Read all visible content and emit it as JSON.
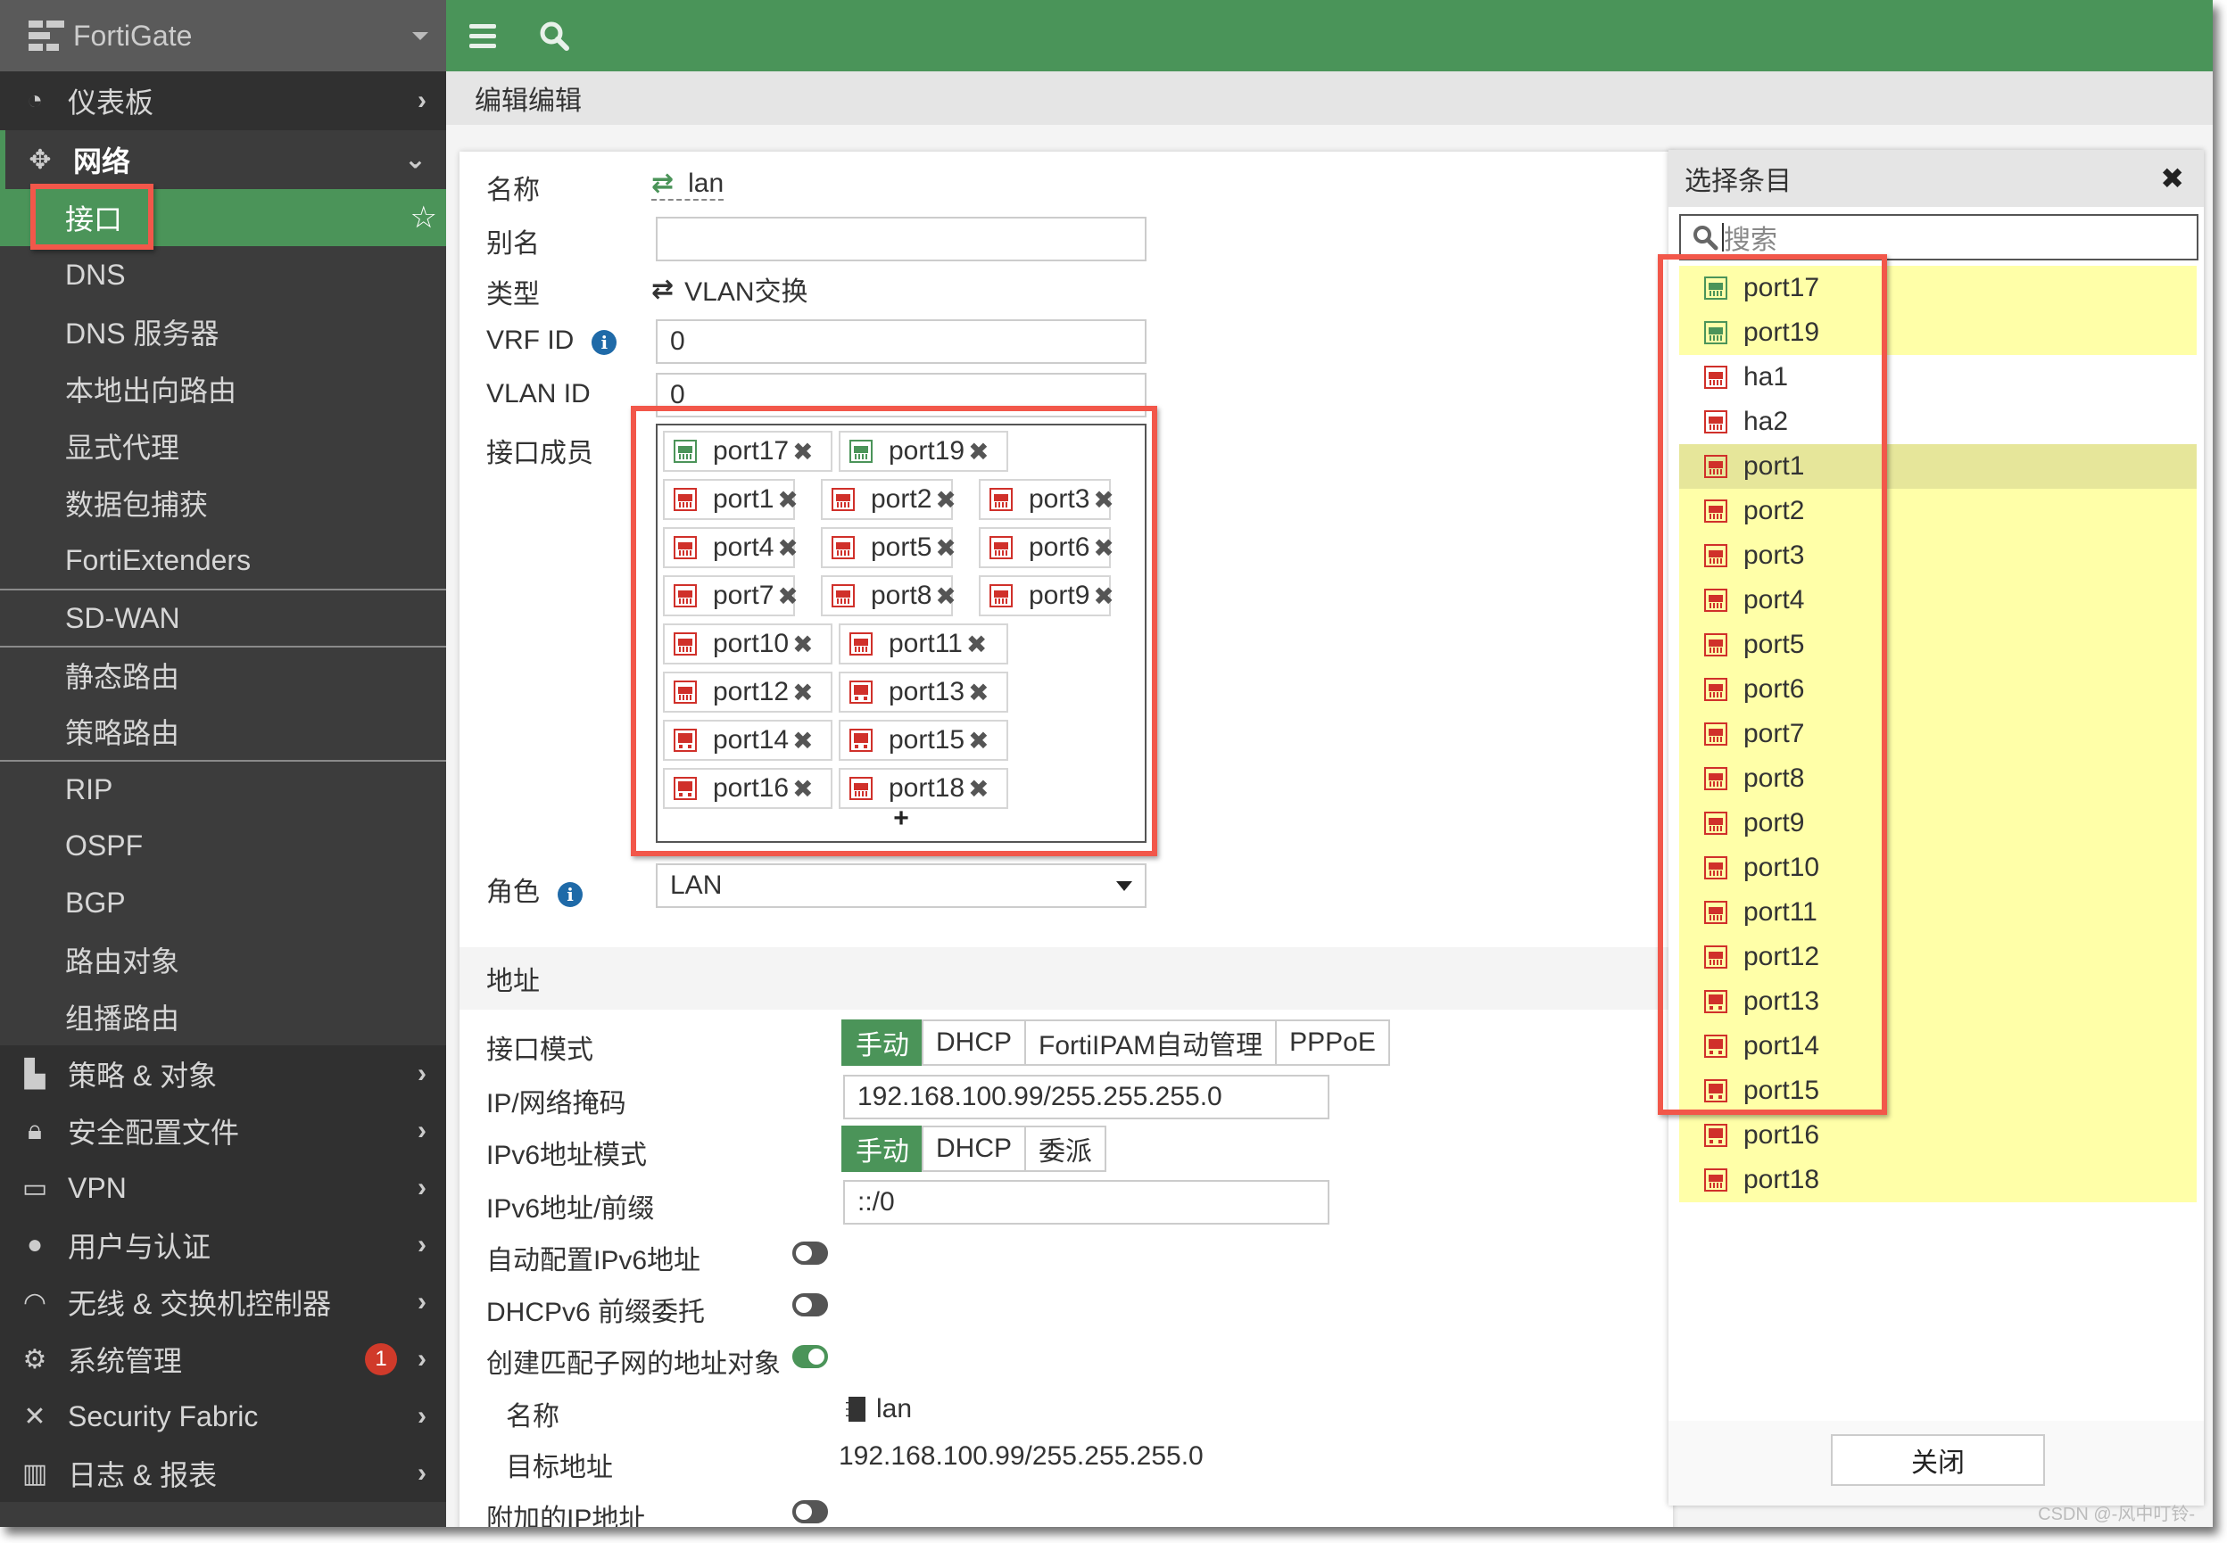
{
  "brand": "FortiGate",
  "topbar": {
    "menu_icon": "hamburger-icon",
    "search_icon": "search-icon"
  },
  "breadcrumb": "编辑编辑",
  "sidebar": {
    "top_items": [
      {
        "label": "仪表板",
        "icon": "dashboard-icon"
      },
      {
        "label": "网络",
        "icon": "network-move-icon",
        "expanded": true
      }
    ],
    "network_sub": [
      "接口",
      "DNS",
      "DNS 服务器",
      "本地出向路由",
      "显式代理",
      "数据包捕获",
      "FortiExtenders",
      "SD-WAN",
      "静态路由",
      "策略路由",
      "RIP",
      "OSPF",
      "BGP",
      "路由对象",
      "组播路由"
    ],
    "active_sub": "接口",
    "bottom_items": [
      {
        "label": "策略 & 对象",
        "icon": "policy-icon"
      },
      {
        "label": "安全配置文件",
        "icon": "lock-icon"
      },
      {
        "label": "VPN",
        "icon": "laptop-icon"
      },
      {
        "label": "用户与认证",
        "icon": "user-icon"
      },
      {
        "label": "无线 & 交换机控制器",
        "icon": "wifi-icon"
      },
      {
        "label": "系统管理",
        "icon": "gear-icon",
        "badge": "1"
      },
      {
        "label": "Security Fabric",
        "icon": "fabric-icon"
      },
      {
        "label": "日志 & 报表",
        "icon": "chart-icon"
      }
    ]
  },
  "form": {
    "name_label": "名称",
    "name_value": "lan",
    "alias_label": "别名",
    "alias_value": "",
    "type_label": "类型",
    "type_value": "VLAN交换",
    "vrf_label": "VRF ID",
    "vrf_value": "0",
    "vlan_label": "VLAN ID",
    "vlan_value": "0",
    "members_label": "接口成员",
    "members": [
      {
        "name": "port17",
        "color": "green",
        "kind": "rj45"
      },
      {
        "name": "port19",
        "color": "green",
        "kind": "rj45"
      },
      {
        "name": "port1",
        "color": "red",
        "kind": "rj45"
      },
      {
        "name": "port2",
        "color": "red",
        "kind": "rj45"
      },
      {
        "name": "port3",
        "color": "red",
        "kind": "rj45"
      },
      {
        "name": "port4",
        "color": "red",
        "kind": "rj45"
      },
      {
        "name": "port5",
        "color": "red",
        "kind": "rj45"
      },
      {
        "name": "port6",
        "color": "red",
        "kind": "rj45"
      },
      {
        "name": "port7",
        "color": "red",
        "kind": "rj45"
      },
      {
        "name": "port8",
        "color": "red",
        "kind": "rj45"
      },
      {
        "name": "port9",
        "color": "red",
        "kind": "rj45"
      },
      {
        "name": "port10",
        "color": "red",
        "kind": "rj45"
      },
      {
        "name": "port11",
        "color": "red",
        "kind": "rj45"
      },
      {
        "name": "port12",
        "color": "red",
        "kind": "rj45"
      },
      {
        "name": "port13",
        "color": "red",
        "kind": "sfp"
      },
      {
        "name": "port14",
        "color": "red",
        "kind": "sfp"
      },
      {
        "name": "port15",
        "color": "red",
        "kind": "sfp"
      },
      {
        "name": "port16",
        "color": "red",
        "kind": "sfp"
      },
      {
        "name": "port18",
        "color": "red",
        "kind": "rj45"
      }
    ],
    "add_label": "+",
    "role_label": "角色",
    "role_value": "LAN",
    "address_section": "地址",
    "mode_label": "接口模式",
    "mode_options": [
      "手动",
      "DHCP",
      "FortiIPAM自动管理",
      "PPPoE"
    ],
    "mode_selected": "手动",
    "ip_label": "IP/网络掩码",
    "ip_value": "192.168.100.99/255.255.255.0",
    "ipv6_mode_label": "IPv6地址模式",
    "ipv6_mode_options": [
      "手动",
      "DHCP",
      "委派"
    ],
    "ipv6_mode_selected": "手动",
    "ipv6_addr_label": "IPv6地址/前缀",
    "ipv6_addr_value": "::/0",
    "auto_ipv6_label": "自动配置IPv6地址",
    "auto_ipv6": false,
    "dhcpv6_label": "DHCPv6 前缀委托",
    "dhcpv6": false,
    "create_obj_label": "创建匹配子网的地址对象",
    "create_obj": true,
    "obj_name_label": "名称",
    "obj_name_value": "lan",
    "dest_label": "目标地址",
    "dest_value": "192.168.100.99/255.255.255.0",
    "extra_ip_label": "附加的IP地址",
    "extra_ip": false
  },
  "picker": {
    "title": "选择条目",
    "search_placeholder": "搜索",
    "items": [
      {
        "name": "port17",
        "color": "green",
        "kind": "rj45",
        "state": "sel"
      },
      {
        "name": "port19",
        "color": "green",
        "kind": "rj45",
        "state": "sel"
      },
      {
        "name": "ha1",
        "color": "red",
        "kind": "rj45",
        "state": ""
      },
      {
        "name": "ha2",
        "color": "red",
        "kind": "rj45",
        "state": ""
      },
      {
        "name": "port1",
        "color": "red",
        "kind": "rj45",
        "state": "hover"
      },
      {
        "name": "port2",
        "color": "red",
        "kind": "rj45",
        "state": "sel"
      },
      {
        "name": "port3",
        "color": "red",
        "kind": "rj45",
        "state": "sel"
      },
      {
        "name": "port4",
        "color": "red",
        "kind": "rj45",
        "state": "sel"
      },
      {
        "name": "port5",
        "color": "red",
        "kind": "rj45",
        "state": "sel"
      },
      {
        "name": "port6",
        "color": "red",
        "kind": "rj45",
        "state": "sel"
      },
      {
        "name": "port7",
        "color": "red",
        "kind": "rj45",
        "state": "sel"
      },
      {
        "name": "port8",
        "color": "red",
        "kind": "rj45",
        "state": "sel"
      },
      {
        "name": "port9",
        "color": "red",
        "kind": "rj45",
        "state": "sel"
      },
      {
        "name": "port10",
        "color": "red",
        "kind": "rj45",
        "state": "sel"
      },
      {
        "name": "port11",
        "color": "red",
        "kind": "rj45",
        "state": "sel"
      },
      {
        "name": "port12",
        "color": "red",
        "kind": "rj45",
        "state": "sel"
      },
      {
        "name": "port13",
        "color": "red",
        "kind": "sfp",
        "state": "sel"
      },
      {
        "name": "port14",
        "color": "red",
        "kind": "sfp",
        "state": "sel"
      },
      {
        "name": "port15",
        "color": "red",
        "kind": "sfp",
        "state": "sel"
      },
      {
        "name": "port16",
        "color": "red",
        "kind": "sfp",
        "state": "sel"
      },
      {
        "name": "port18",
        "color": "red",
        "kind": "rj45",
        "state": "sel"
      }
    ],
    "close_label": "关闭"
  },
  "watermark": "CSDN @-风中叮铃-",
  "colors": {
    "accent": "#4a9459",
    "highlight": "#ffffa8",
    "annotation": "#f2574a",
    "port_red": "#d0302a"
  }
}
